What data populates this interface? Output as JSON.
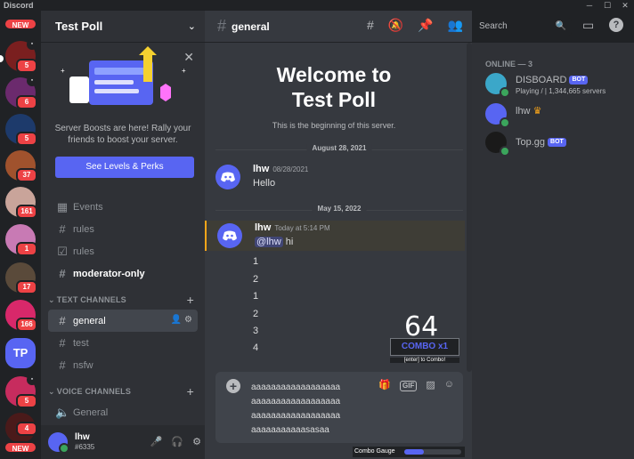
{
  "app": {
    "title": "Discord"
  },
  "servers": {
    "new_label": "NEW",
    "badges": [
      "5",
      "6",
      "5",
      "37",
      "161",
      "1",
      "17",
      "166",
      "5"
    ],
    "tp_label": "TP",
    "new_bottom_label": "NEW",
    "bottom_badge": "4"
  },
  "sidebar": {
    "server_name": "Test Poll",
    "boost": {
      "text": "Server Boosts are here! Rally your friends to boost your server.",
      "button": "See Levels & Perks"
    },
    "channels": [
      {
        "name": "Events",
        "icon": "calendar-icon"
      },
      {
        "name": "rules",
        "icon": "hash-icon"
      },
      {
        "name": "rules",
        "icon": "checkbox-icon"
      },
      {
        "name": "moderator-only",
        "icon": "hash-icon"
      }
    ],
    "text_category": "TEXT CHANNELS",
    "text_channels": [
      "general",
      "test",
      "nsfw"
    ],
    "voice_category": "VOICE CHANNELS",
    "voice_channels": [
      "General"
    ],
    "user": {
      "name": "lhw",
      "tag": "#6335"
    }
  },
  "header": {
    "channel": "general",
    "search_placeholder": "Search"
  },
  "welcome": {
    "line1": "Welcome to",
    "line2": "Test Poll",
    "sub": "This is the beginning of this server."
  },
  "messages": {
    "date1": "August 28, 2021",
    "m1": {
      "author": "lhw",
      "time": "08/28/2021",
      "text": "Hello"
    },
    "date2": "May 15, 2022",
    "m2": {
      "author": "lhw",
      "time": "Today at 5:14 PM",
      "mention": "@lhw",
      "text": "hi",
      "lines": [
        "1",
        "2",
        "1",
        "2",
        "3",
        "4"
      ]
    }
  },
  "combo": {
    "count": "64",
    "label": "COMBO x1",
    "hint": "[enter] to Combo!",
    "gauge_label": "Combo Gauge",
    "gauge_fraction": 0.35
  },
  "composer": {
    "lines": [
      "aaaaaaaaaaaaaaaaaa",
      "aaaaaaaaaaaaaaaaaa",
      "aaaaaaaaaaaaaaaaaa",
      "aaaaaaaaaaasasaa"
    ],
    "gif_label": "GIF"
  },
  "members": {
    "header": "ONLINE — 3",
    "list": [
      {
        "name": "DISBOARD",
        "bot": "BOT",
        "activity": "Playing / | 1,344,665 servers"
      },
      {
        "name": "lhw",
        "crown": "♛"
      },
      {
        "name": "Top.gg",
        "bot": "BOT"
      }
    ]
  },
  "colors": {
    "blurple": "#5865f2",
    "online": "#3ba55c",
    "badge": "#ed4245",
    "mention_bar": "#faa61a"
  }
}
